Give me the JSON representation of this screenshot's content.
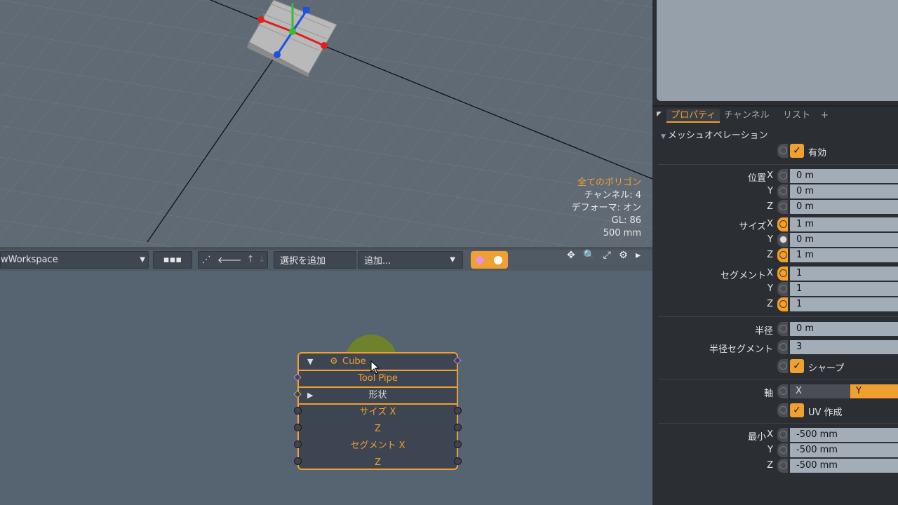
{
  "viewport": {
    "info": {
      "line1": "全てのポリゴン",
      "line2": "チャンネル: 4",
      "line3": "デフォーマ: オン",
      "line4": "GL: 86",
      "line5": "500 mm"
    }
  },
  "toolbar": {
    "workspace": "wWorkspace",
    "select_add": "選択を追加",
    "add": "追加..."
  },
  "node": {
    "title": "Cube",
    "tool_pipe": "Tool Pipe",
    "shape": "形状",
    "rows": [
      "サイズ X",
      "Z",
      "セグメント X",
      "Z"
    ]
  },
  "panel": {
    "tabs": [
      "プロパティ",
      "チャンネル",
      "リスト",
      "+"
    ],
    "section": "メッシュオペレーション",
    "enabled": "有効",
    "position": {
      "label": "位置",
      "x": "0 m",
      "y": "0 m",
      "z": "0 m"
    },
    "size": {
      "label": "サイズ",
      "x": "1 m",
      "y": "0 m",
      "z": "1 m"
    },
    "segment": {
      "label": "セグメント",
      "x": "1",
      "y": "1",
      "z": "1"
    },
    "radius": {
      "label": "半径",
      "value": "0 m"
    },
    "radius_segment": {
      "label": "半径セグメント",
      "value": "3"
    },
    "sharp": "シャープ",
    "axis": {
      "label": "軸",
      "x": "X",
      "y": "Y"
    },
    "uv": "UV 作成",
    "min": {
      "label": "最小",
      "x": "-500 mm",
      "y": "-500 mm",
      "z": "-500 mm"
    },
    "axis_letters": {
      "x": "X",
      "y": "Y",
      "z": "Z"
    }
  },
  "colors": {
    "accent": "#f0a030"
  }
}
